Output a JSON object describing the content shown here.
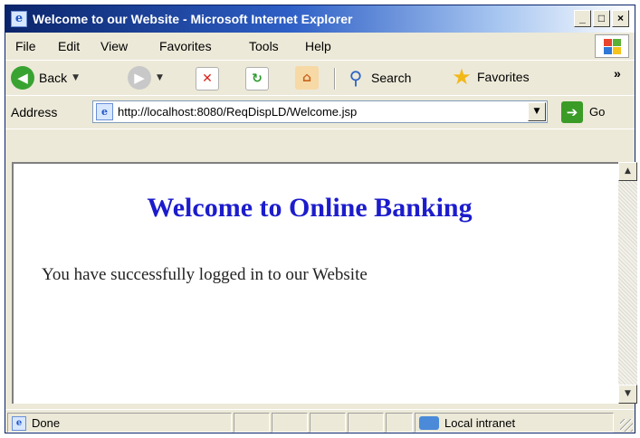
{
  "window": {
    "title": "Welcome to our Website - Microsoft Internet Explorer",
    "controls": {
      "minimize": "_",
      "maximize": "□",
      "close": "×"
    }
  },
  "menu": [
    "File",
    "Edit",
    "View",
    "Favorites",
    "Tools",
    "Help"
  ],
  "toolbar": {
    "back_label": "Back",
    "search_label": "Search",
    "favorites_label": "Favorites",
    "overflow": "»"
  },
  "address": {
    "label": "Address",
    "url": "http://localhost:8080/ReqDispLD/Welcome.jsp",
    "go_label": "Go"
  },
  "page": {
    "heading": "Welcome to Online Banking",
    "message": "You have successfully logged in to our Website"
  },
  "status": {
    "text": "Done",
    "zone": "Local intranet"
  },
  "colors": {
    "heading": "#1c1ccc",
    "titlebar": "#0a246a",
    "chrome": "#ece9d8"
  },
  "icons": {
    "page_icon": "ie-page-icon",
    "back": "back-arrow-icon",
    "forward": "forward-arrow-icon",
    "stop": "stop-icon",
    "refresh": "refresh-icon",
    "home": "home-icon",
    "search": "search-icon",
    "favorites": "star-icon",
    "go": "go-arrow-icon",
    "zone": "intranet-icon"
  }
}
